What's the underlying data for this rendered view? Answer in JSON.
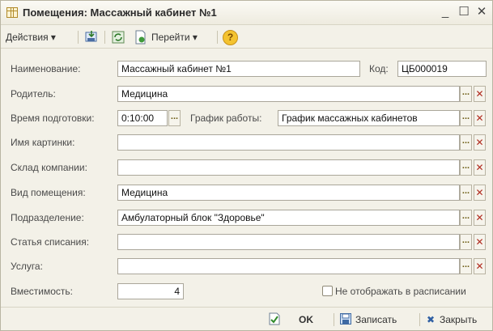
{
  "window": {
    "title": "Помещения: Массажный кабинет №1",
    "minimize": "_",
    "maximize": "☐",
    "close": "✕"
  },
  "toolbar": {
    "actions_label": "Действия ▾",
    "goto_label": "Перейти ▾",
    "help_label": "?"
  },
  "form": {
    "name_label": "Наименование:",
    "name_value": "Массажный кабинет №1",
    "code_label": "Код:",
    "code_value": "ЦБ000019",
    "parent_label": "Родитель:",
    "parent_value": "Медицина",
    "prep_time_label": "Время подготовки:",
    "prep_time_value": "0:10:00",
    "schedule_label": "График работы:",
    "schedule_value": "График массажных кабинетов",
    "picture_label": "Имя картинки:",
    "picture_value": "",
    "warehouse_label": "Склад компании:",
    "warehouse_value": "",
    "room_type_label": "Вид помещения:",
    "room_type_value": "Медицина",
    "department_label": "Подразделение:",
    "department_value": "Амбулаторный блок \"Здоровье\"",
    "writeoff_label": "Статья списания:",
    "writeoff_value": "",
    "service_label": "Услуга:",
    "service_value": "",
    "capacity_label": "Вместимость:",
    "capacity_value": "4",
    "hide_in_schedule_label": "Не отображать в расписании",
    "hide_in_schedule_checked": false,
    "select_glyph": "...",
    "clear_glyph": "✕"
  },
  "footer": {
    "ok_label": "OK",
    "save_label": "Записать",
    "close_label": "Закрыть"
  }
}
